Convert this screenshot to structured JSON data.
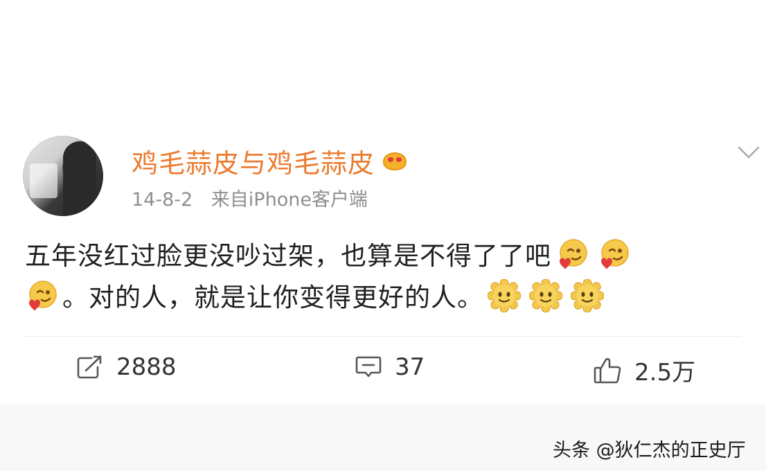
{
  "post": {
    "author": "鸡毛蒜皮与鸡毛蒜皮",
    "date": "14-8-2",
    "source": "来自iPhone客户端",
    "text_part1": "五年没红过脸更没吵过架，也算是不得了了吧",
    "text_part2": "。对的人，就是让你变得更好的人。",
    "emojis_line1": [
      "heart-face-emoji",
      "heart-face-emoji",
      "heart-face-emoji"
    ],
    "emojis_line2": [
      "sun-smile-emoji",
      "sun-smile-emoji",
      "sun-smile-emoji"
    ]
  },
  "actions": {
    "repost_count": "2888",
    "comment_count": "37",
    "like_count": "2.5万"
  },
  "watermark": "头条 @狄仁杰的正史厅",
  "colors": {
    "username": "#ec7b2f",
    "meta": "#8e8e8e",
    "text": "#1f1f1f"
  }
}
